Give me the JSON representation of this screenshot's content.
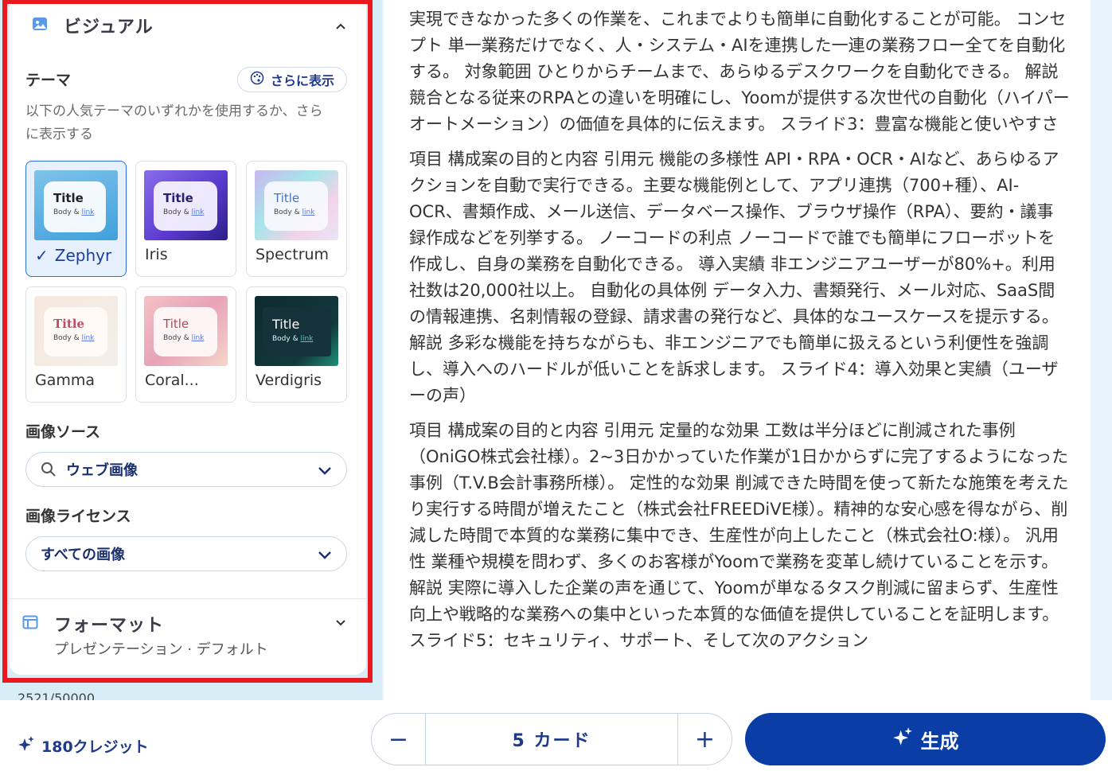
{
  "visual": {
    "title": "ビジュアル",
    "icon": "image-icon"
  },
  "theme": {
    "label": "テーマ",
    "more_label": "さらに表示",
    "description": "以下の人気テーマのいずれかを使用するか、さらに表示する",
    "cards": [
      {
        "name": "Zephyr",
        "title": "Title",
        "body": "Body &",
        "link": "link",
        "selected": true
      },
      {
        "name": "Iris",
        "title": "Title",
        "body": "Body &",
        "link": "link"
      },
      {
        "name": "Spectrum",
        "title": "Title",
        "body": "Body &",
        "link": "link"
      },
      {
        "name": "Gamma",
        "title": "Title",
        "body": "Body &",
        "link": "link"
      },
      {
        "name": "Coral...",
        "title": "Title",
        "body": "Body &",
        "link": "link"
      },
      {
        "name": "Verdigris",
        "title": "Title",
        "body": "Body &",
        "link": "link"
      }
    ]
  },
  "image_source": {
    "label": "画像ソース",
    "value": "ウェブ画像"
  },
  "image_license": {
    "label": "画像ライセンス",
    "value": "すべての画像"
  },
  "format": {
    "title": "フォーマット",
    "subtitle": "プレゼンテーション · デフォルト"
  },
  "peek_text": "2521/50000",
  "content": {
    "paragraphs": [
      "実現できなかった多くの作業を、これまでよりも簡単に自動化することが可能。 コンセプト 単一業務だけでなく、人・システム・AIを連携した一連の業務フロー全てを自動化する。 対象範囲 ひとりからチームまで、あらゆるデスクワークを自動化できる。 解説 競合となる従来のRPAとの違いを明確にし、Yoomが提供する次世代の自動化（ハイパーオートメーション）の価値を具体的に伝えます。 スライド3：豊富な機能と使いやすさ",
      "項目 構成案の目的と内容 引用元 機能の多様性 API・RPA・OCR・AIなど、あらゆるアクションを自動で実行できる。主要な機能例として、アプリ連携（700+種）、AI-OCR、書類作成、メール送信、データベース操作、ブラウザ操作（RPA）、要約・議事録作成などを列挙する。 ノーコードの利点 ノーコードで誰でも簡単にフローボットを作成し、自身の業務を自動化できる。 導入実績 非エンジニアユーザーが80%+。利用社数は20,000社以上。 自動化の具体例 データ入力、書類発行、メール対応、SaaS間の情報連携、名刺情報の登録、請求書の発行など、具体的なユースケースを提示する。 解説 多彩な機能を持ちながらも、非エンジニアでも簡単に扱えるという利便性を強調し、導入へのハードルが低いことを訴求します。 スライド4：導入効果と実績（ユーザーの声）",
      "項目 構成案の目的と内容 引用元 定量的な効果 工数は半分ほどに削減された事例（OniGO株式会社様）。2~3日かかっていた作業が1日かからずに完了するようになった事例（T.V.B会計事務所様）。 定性的な効果 削減できた時間を使って新たな施策を考えたり実行する時間が増えたこと（株式会社FREEDiVE様）。精神的な安心感を得ながら、削減した時間で本質的な業務に集中でき、生産性が向上したこと（株式会社O:様）。 汎用性 業種や規模を問わず、多くのお客様がYoomで業務を変革し続けていることを示す。 解説 実際に導入した企業の声を通じて、Yoomが単なるタスク削減に留まらず、生産性向上や戦略的な業務への集中といった本質的な価値を提供していることを証明します。 スライド5：セキュリティ、サポート、そして次のアクション"
    ]
  },
  "footer": {
    "credits": "180クレジット",
    "card_count": "5 カード",
    "minus": "−",
    "plus": "+",
    "generate": "生成"
  },
  "colors": {
    "accent": "#0a3ea6",
    "highlight": "#e8191f",
    "selected_bg": "#e7f1fd"
  }
}
